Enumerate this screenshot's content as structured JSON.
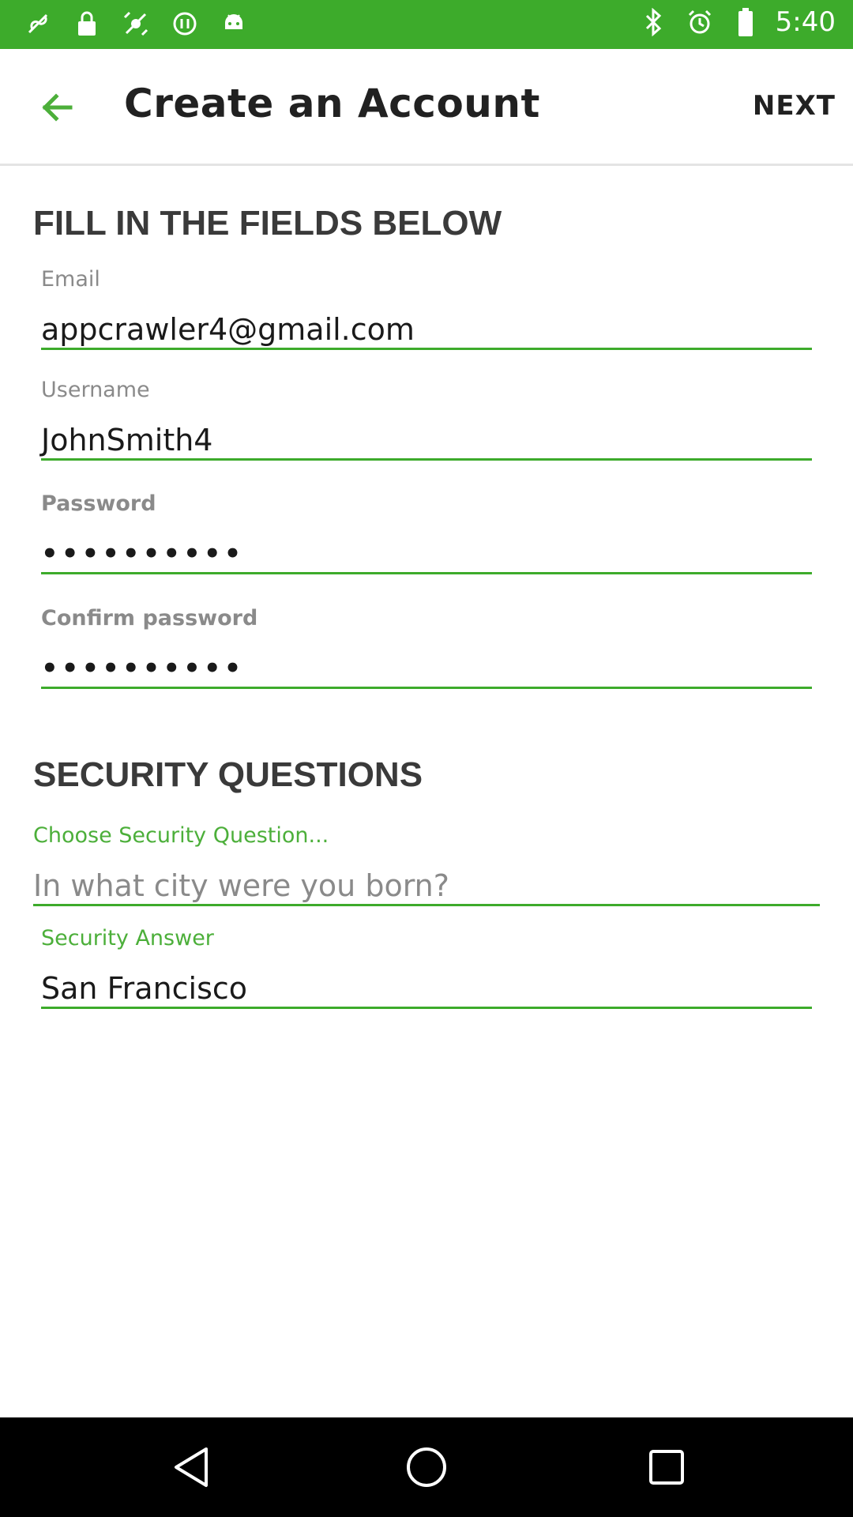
{
  "status_bar": {
    "time": "5:40",
    "icons": [
      "notification-icon",
      "lock-icon",
      "fake-gps-icon",
      "circle-icon",
      "android-icon",
      "bluetooth-icon",
      "alarm-icon",
      "battery-icon"
    ]
  },
  "app_bar": {
    "title": "Create an Account",
    "next_label": "NEXT"
  },
  "form": {
    "heading": "FILL IN THE FIELDS BELOW",
    "email": {
      "label": "Email",
      "value": "appcrawler4@gmail.com"
    },
    "username": {
      "label": "Username",
      "value": "JohnSmith4"
    },
    "password": {
      "label": "Password",
      "value": "••••••••••"
    },
    "confirm_password": {
      "label": "Confirm password",
      "value": "••••••••••"
    }
  },
  "security": {
    "heading": "SECURITY QUESTIONS",
    "question": {
      "label": "Choose Security Question...",
      "value": "In what city were you born?"
    },
    "answer": {
      "label": "Security Answer",
      "value": "San Francisco"
    }
  },
  "colors": {
    "accent": "#3dab2b",
    "label_green": "#4caf3a",
    "text": "#1a1a1a",
    "muted": "#8a8a8a"
  }
}
